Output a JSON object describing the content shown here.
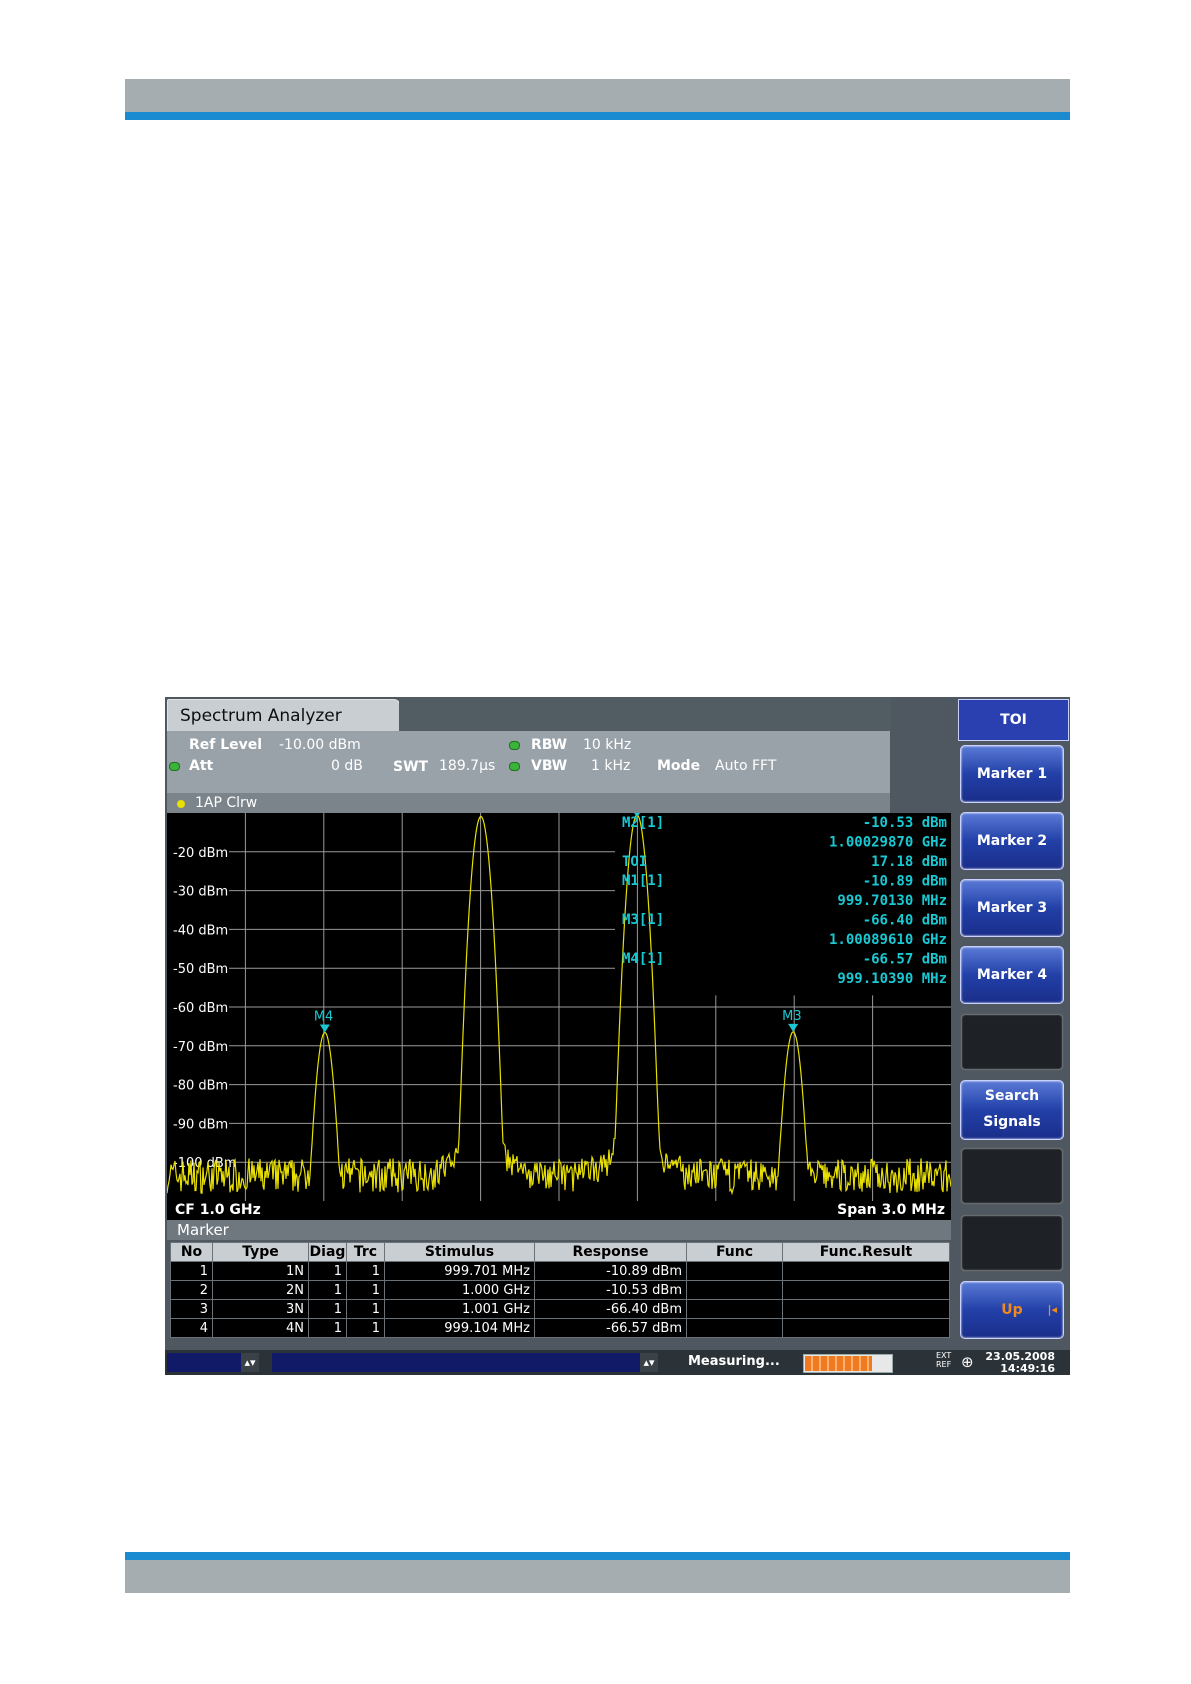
{
  "window": {
    "title": "Spectrum Analyzer"
  },
  "settings": {
    "ref_level_label": "Ref Level",
    "ref_level_value": "-10.00 dBm",
    "att_label": "Att",
    "att_value": "0 dB",
    "swt_label": "SWT",
    "swt_value": "189.7µs",
    "rbw_label": "RBW",
    "rbw_value": "10 kHz",
    "vbw_label": "VBW",
    "vbw_value": "1 kHz",
    "mode_label": "Mode",
    "mode_value": "Auto FFT"
  },
  "trace": {
    "label": "1AP Clrw"
  },
  "plot": {
    "y_ticks": [
      "-20 dBm",
      "-30 dBm",
      "-40 dBm",
      "-50 dBm",
      "-60 dBm",
      "-70 dBm",
      "-80 dBm",
      "-90 dBm",
      "-100 dBm"
    ],
    "markers_on_trace": [
      {
        "label": "M4",
        "freq_mhz": 999.104,
        "level_dbm": -66.57
      },
      {
        "label": "M3",
        "freq_mhz": 1000.896,
        "level_dbm": -66.4
      }
    ],
    "readout": {
      "m2_label": "M2[1]",
      "m2_level": "-10.53 dBm",
      "m2_freq": "1.00029870 GHz",
      "toi_label": "TOI",
      "toi_value": "17.18 dBm",
      "m1_label": "M1[1]",
      "m1_level": "-10.89 dBm",
      "m1_freq": "999.70130 MHz",
      "m3_label": "M3[1]",
      "m3_level": "-66.40 dBm",
      "m3_freq": "1.00089610 GHz",
      "m4_label": "M4[1]",
      "m4_level": "-66.57 dBm",
      "m4_freq": "999.10390 MHz"
    },
    "cf": "CF 1.0 GHz",
    "span": "Span 3.0 MHz",
    "colors": {
      "trace": "#e8e000",
      "marker": "#19c8d2",
      "grid": "#9a9a9a"
    }
  },
  "marker_table": {
    "title": "Marker",
    "columns": [
      "No",
      "Type",
      "Diag",
      "Trc",
      "Stimulus",
      "Response",
      "Func",
      "Func.Result"
    ],
    "rows": [
      [
        "1",
        "1N",
        "1",
        "1",
        "999.701 MHz",
        "-10.89 dBm",
        "",
        ""
      ],
      [
        "2",
        "2N",
        "1",
        "1",
        "1.000 GHz",
        "-10.53 dBm",
        "",
        ""
      ],
      [
        "3",
        "3N",
        "1",
        "1",
        "1.001 GHz",
        "-66.40 dBm",
        "",
        ""
      ],
      [
        "4",
        "4N",
        "1",
        "1",
        "999.104 MHz",
        "-66.57 dBm",
        "",
        ""
      ]
    ]
  },
  "softkeys": {
    "title": "TOI",
    "keys": [
      {
        "line1": "Marker 1",
        "line2": ""
      },
      {
        "line1": "Marker 2",
        "line2": ""
      },
      {
        "line1": "Marker 3",
        "line2": ""
      },
      {
        "line1": "Marker 4",
        "line2": ""
      },
      {
        "line1": "",
        "line2": ""
      },
      {
        "line1": "Search",
        "line2": "Signals"
      },
      {
        "line1": "",
        "line2": ""
      },
      {
        "line1": "",
        "line2": ""
      },
      {
        "line1": "Up",
        "line2": ""
      }
    ]
  },
  "status": {
    "measuring": "Measuring...",
    "progress": 0.8,
    "ext": "EXT",
    "ref": "REF",
    "date": "23.05.2008",
    "time": "14:49:16"
  }
}
